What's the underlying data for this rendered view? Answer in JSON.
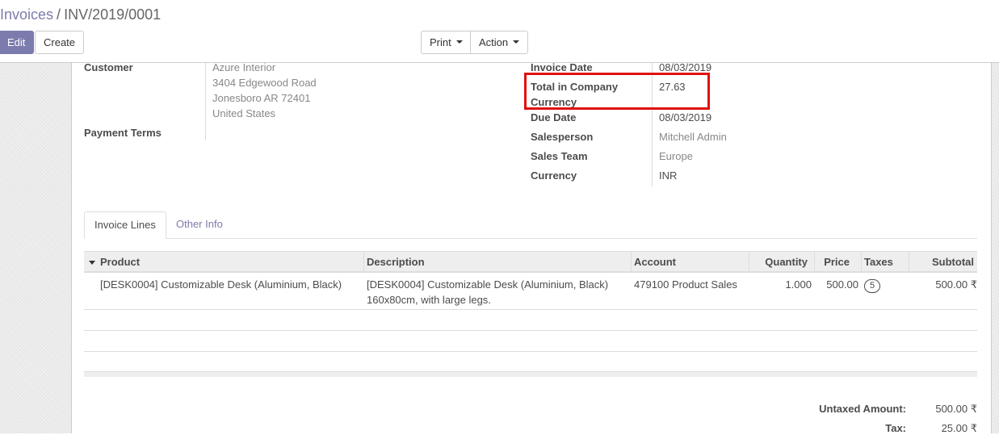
{
  "breadcrumb": {
    "parent": "Invoices",
    "separator": "/",
    "current": "INV/2019/0001"
  },
  "buttons": {
    "edit": "Edit",
    "create": "Create",
    "print": "Print",
    "action": "Action"
  },
  "customer": {
    "label": "Customer",
    "name": "Azure Interior",
    "address_line1": "3404 Edgewood Road",
    "address_line2": "Jonesboro AR 72401",
    "country": "United States"
  },
  "payment_terms": {
    "label": "Payment Terms",
    "value": ""
  },
  "invoice_info": {
    "invoice_date_label": "Invoice Date",
    "invoice_date": "08/03/2019",
    "total_company_currency_label_line1": "Total in Company",
    "total_company_currency_label_line2": "Currency",
    "total_company_currency": "27.63",
    "due_date_label": "Due Date",
    "due_date": "08/03/2019",
    "salesperson_label": "Salesperson",
    "salesperson": "Mitchell Admin",
    "sales_team_label": "Sales Team",
    "sales_team": "Europe",
    "currency_label": "Currency",
    "currency": "INR"
  },
  "tabs": [
    {
      "label": "Invoice Lines",
      "active": true
    },
    {
      "label": "Other Info",
      "active": false
    }
  ],
  "invoice_lines": {
    "columns": [
      "Product",
      "Description",
      "Account",
      "Quantity",
      "Price",
      "Taxes",
      "Subtotal"
    ],
    "rows": [
      {
        "product": "[DESK0004] Customizable Desk (Aluminium, Black)",
        "description_line1": "[DESK0004] Customizable Desk (Aluminium, Black)",
        "description_line2": "160x80cm, with large legs.",
        "account": "479100 Product Sales",
        "quantity": "1.000",
        "price": "500.00",
        "taxes": "5",
        "subtotal": "500.00 ₹"
      }
    ]
  },
  "totals": {
    "untaxed_label": "Untaxed Amount:",
    "untaxed_value": "500.00 ₹",
    "tax_label": "Tax:",
    "tax_value": "25.00 ₹"
  },
  "colors": {
    "brand": "#7c7bad",
    "highlight": "#e01010"
  }
}
